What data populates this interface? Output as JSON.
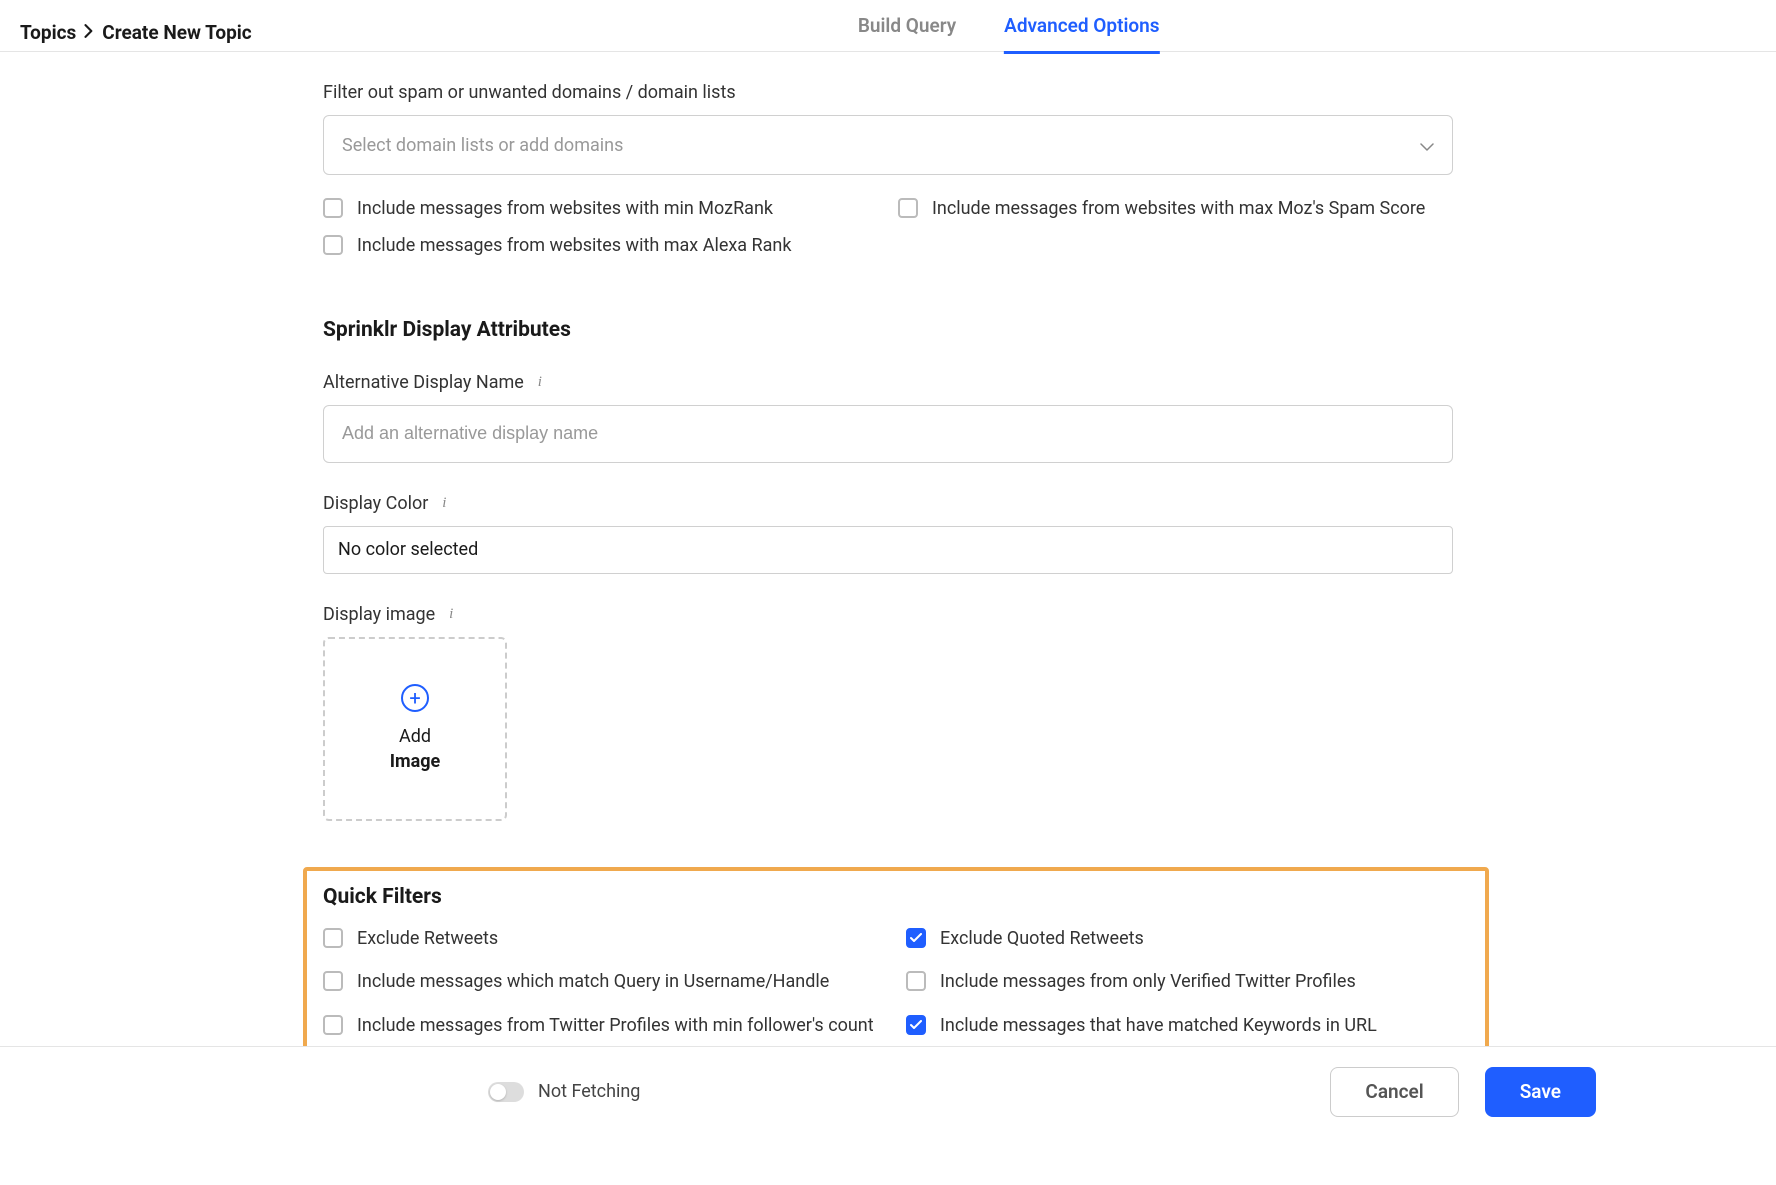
{
  "breadcrumb": {
    "root": "Topics",
    "current": "Create New Topic"
  },
  "tabs": {
    "build_query": "Build Query",
    "advanced_options": "Advanced Options"
  },
  "spam_filter": {
    "label": "Filter out spam or unwanted domains / domain lists",
    "placeholder": "Select domain lists or add domains",
    "options": {
      "min_mozrank": "Include messages from websites with min MozRank",
      "max_spam_score": "Include messages from websites with max Moz's Spam Score",
      "max_alexa_rank": "Include messages from websites with max Alexa Rank"
    }
  },
  "display_attrs": {
    "heading": "Sprinklr Display Attributes",
    "alt_name_label": "Alternative Display Name",
    "alt_name_placeholder": "Add an alternative display name",
    "color_label": "Display Color",
    "color_value": "No color selected",
    "image_label": "Display image",
    "upload_line1": "Add",
    "upload_line2": "Image"
  },
  "quick_filters": {
    "heading": "Quick Filters",
    "items": [
      {
        "label": "Exclude Retweets",
        "checked": false
      },
      {
        "label": "Exclude Quoted Retweets",
        "checked": true
      },
      {
        "label": "Include messages which match Query in Username/Handle",
        "checked": false
      },
      {
        "label": "Include messages from only Verified Twitter Profiles",
        "checked": false
      },
      {
        "label": "Include messages from Twitter Profiles with min follower's count",
        "checked": false
      },
      {
        "label": "Include messages that have matched Keywords in URL",
        "checked": true
      }
    ]
  },
  "footer": {
    "fetch_label": "Not Fetching",
    "cancel": "Cancel",
    "save": "Save"
  }
}
